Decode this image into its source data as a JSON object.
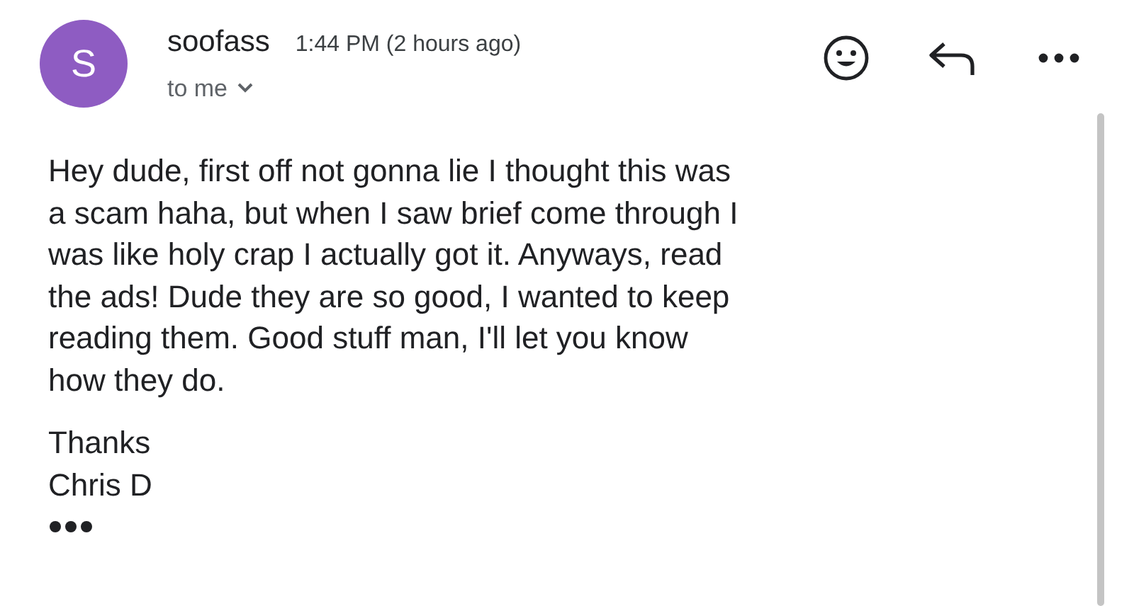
{
  "sender": {
    "avatar_letter": "S",
    "name": "soofass",
    "time": "1:44 PM (2 hours ago)",
    "recipient": "to me"
  },
  "body": {
    "lines": [
      "Hey dude, first off not gonna lie I thought this was",
      "a scam haha, but when I saw brief come through I",
      "was like holy crap I actually got it. Anyways, read",
      "the ads! Dude they are so good, I wanted to keep",
      "reading them. Good stuff man, I'll let you know",
      "how they do."
    ],
    "signature": [
      "Thanks",
      "Chris D"
    ]
  }
}
